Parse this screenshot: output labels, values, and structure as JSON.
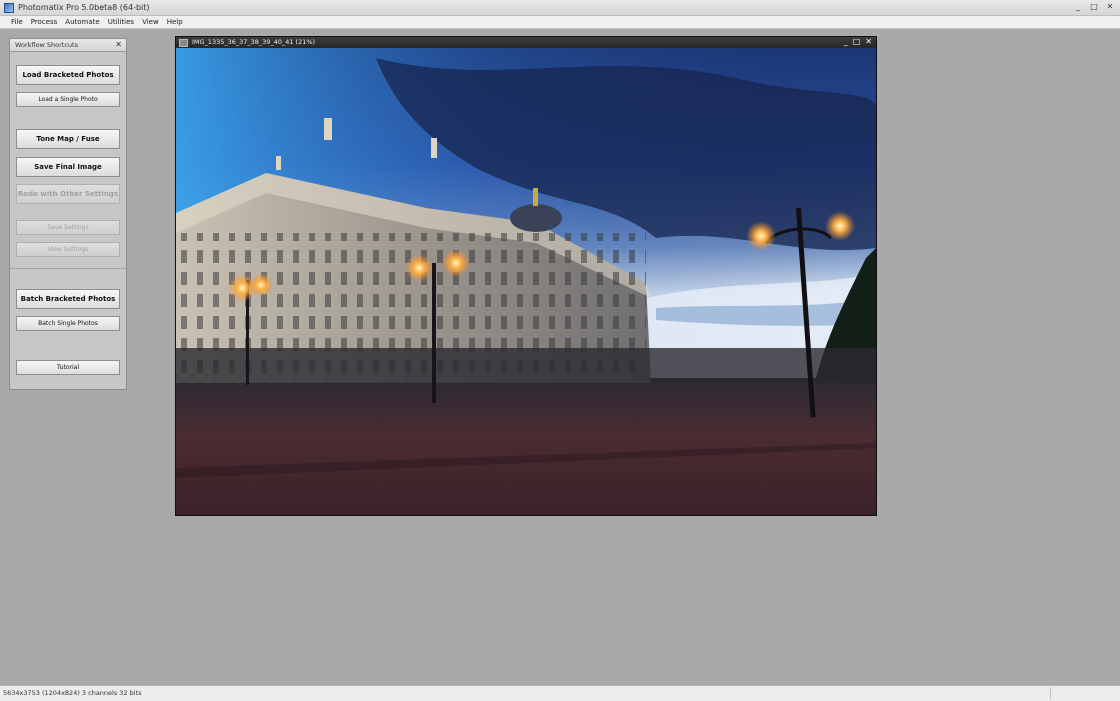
{
  "window": {
    "title": "Photomatix Pro 5.0beta8 (64-bit)",
    "controls": {
      "minimize": "_",
      "maximize": "□",
      "close": "✕"
    }
  },
  "menu": [
    "File",
    "Process",
    "Automate",
    "Utilities",
    "View",
    "Help"
  ],
  "workflow_panel": {
    "title": "Workflow Shortcuts",
    "close": "✕",
    "buttons": {
      "load_bracketed": "Load Bracketed Photos",
      "load_single": "Load a Single Photo",
      "tone_map": "Tone Map / Fuse",
      "save_final": "Save Final Image",
      "redo": "Redo with Other Settings",
      "save_settings": "Save Settings",
      "view_settings": "View Settings",
      "batch_bracketed": "Batch Bracketed Photos",
      "batch_single": "Batch Single Photos",
      "tutorial": "Tutorial"
    }
  },
  "image_window": {
    "title": "IMG_1335_36_37_38_39_40_41 (21%)",
    "controls": {
      "minimize": "_",
      "maximize": "□",
      "close": "✕"
    }
  },
  "status": {
    "text": "5634x3753 (1204x824) 3 channels 32 bits"
  },
  "colors": {
    "app_background": "#a9a9a9",
    "panel_background": "#c7c7c7",
    "sky_top": "#1e3a78",
    "lamp_glow": "#ffb347"
  }
}
